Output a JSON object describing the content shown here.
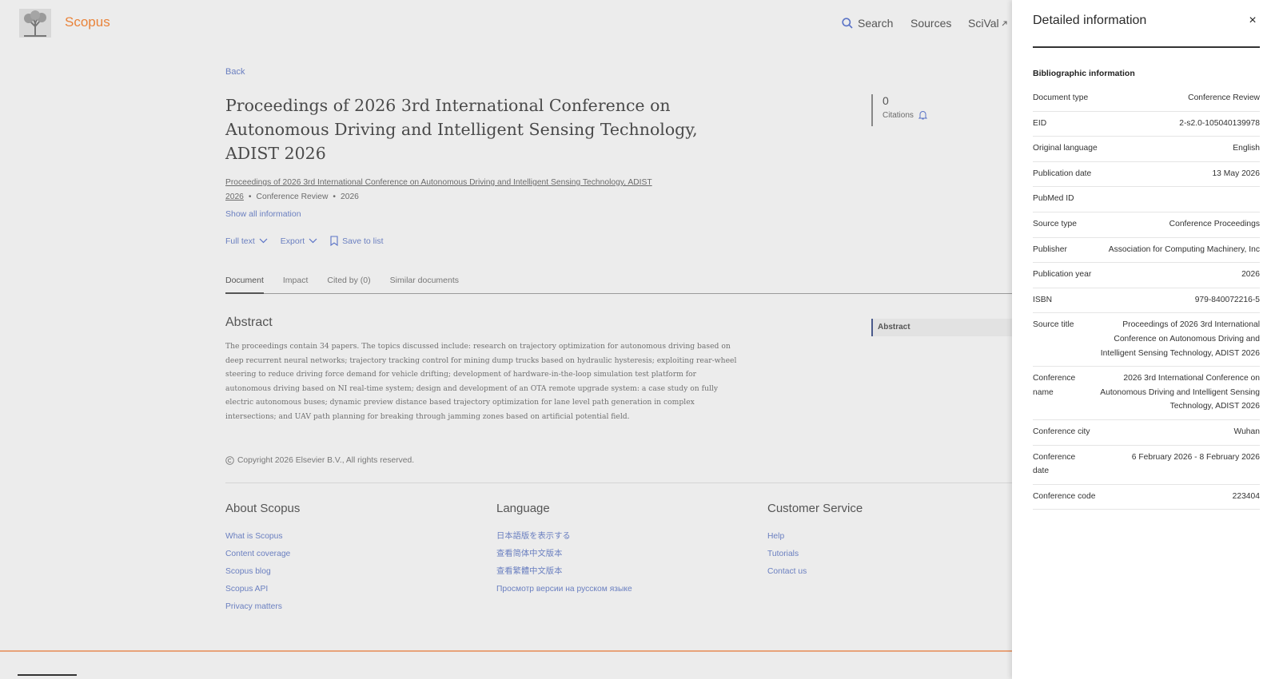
{
  "header": {
    "brand": "Scopus",
    "nav": {
      "search": "Search",
      "sources": "Sources",
      "scival": "SciVal"
    }
  },
  "document": {
    "back": "Back",
    "title": "Proceedings of 2026 3rd International Conference on Autonomous Driving and Intelligent Sensing Technology, ADIST 2026",
    "citations": {
      "count": "0",
      "label": "Citations"
    },
    "source_title": "Proceedings of 2026 3rd International Conference on Autonomous Driving and Intelligent Sensing Technology, ADIST 2026",
    "doc_type": "Conference Review",
    "year": "2026",
    "show_all": "Show all information",
    "actions": {
      "full_text": "Full text",
      "export": "Export",
      "save": "Save to list"
    },
    "tabs": [
      "Document",
      "Impact",
      "Cited by (0)",
      "Similar documents"
    ],
    "abstract_heading": "Abstract",
    "abstract": "The proceedings contain 34 papers. The topics discussed include: research on trajectory optimization for autonomous driving based on deep recurrent neural networks; trajectory tracking control for mining dump trucks based on hydraulic hysteresis; exploiting rear-wheel steering to reduce driving force demand for vehicle drifting; development of hardware-in-the-loop simulation test platform for autonomous driving based on NI real-time system; design and development of an OTA remote upgrade system: a case study on fully electric autonomous buses; dynamic preview distance based trajectory optimization for lane level path generation in complex intersections; and UAV path planning for breaking through jamming zones based on artificial potential field.",
    "outline_item": "Abstract",
    "copyright": "Copyright 2026 Elsevier B.V., All rights reserved."
  },
  "footer": {
    "about": {
      "heading": "About Scopus",
      "links": [
        "What is Scopus",
        "Content coverage",
        "Scopus blog",
        "Scopus API",
        "Privacy matters"
      ]
    },
    "language": {
      "heading": "Language",
      "links": [
        "日本語版を表示する",
        "查看简体中文版本",
        "查看繁體中文版本",
        "Просмотр версии на русском языке"
      ]
    },
    "service": {
      "heading": "Customer Service",
      "links": [
        "Help",
        "Tutorials",
        "Contact us"
      ]
    }
  },
  "panel": {
    "title": "Detailed information",
    "close": "×",
    "section": "Bibliographic information",
    "rows": [
      {
        "k": "Document type",
        "v": "Conference Review"
      },
      {
        "k": "EID",
        "v": "2-s2.0-105040139978"
      },
      {
        "k": "Original language",
        "v": "English"
      },
      {
        "k": "Publication date",
        "v": "13 May 2026"
      },
      {
        "k": "PubMed ID",
        "v": ""
      },
      {
        "k": "Source type",
        "v": "Conference Proceedings"
      },
      {
        "k": "Publisher",
        "v": "Association for Computing Machinery, Inc"
      },
      {
        "k": "Publication year",
        "v": "2026"
      },
      {
        "k": "ISBN",
        "v": "979-840072216-5"
      },
      {
        "k": "Source title",
        "v": "Proceedings of 2026 3rd International Conference on Autonomous Driving and Intelligent Sensing Technology, ADIST 2026"
      },
      {
        "k": "Conference name",
        "v": "2026 3rd International Conference on Autonomous Driving and Intelligent Sensing Technology, ADIST 2026"
      },
      {
        "k": "Conference city",
        "v": "Wuhan"
      },
      {
        "k": "Conference date",
        "v": "6 February 2026 - 8 February 2026"
      },
      {
        "k": "Conference code",
        "v": "223404"
      }
    ]
  },
  "colors": {
    "brand": "#e9711c",
    "link": "#6a7fc0",
    "overlay_bg": "#ececec",
    "panel_bg": "#ffffff"
  }
}
